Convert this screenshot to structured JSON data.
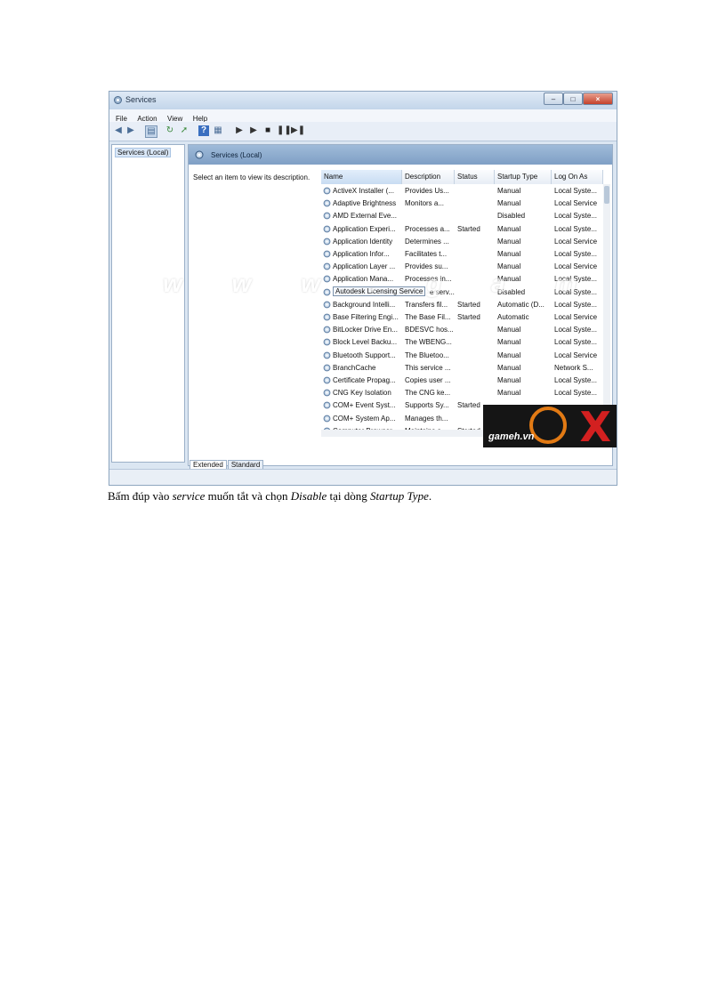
{
  "window": {
    "title": "Services",
    "min": "–",
    "max": "□",
    "close": "×"
  },
  "menu": [
    "File",
    "Action",
    "View",
    "Help"
  ],
  "tree": {
    "item": "Services (Local)"
  },
  "pane": {
    "header": "Services (Local)",
    "description": "Select an item to view its description."
  },
  "columns": [
    "Name",
    "Description",
    "Status",
    "Startup Type",
    "Log On As"
  ],
  "rows": [
    {
      "name": "ActiveX Installer (...",
      "desc": "Provides Us...",
      "status": "",
      "startup": "Manual",
      "logon": "Local Syste..."
    },
    {
      "name": "Adaptive Brightness",
      "desc": "Monitors a...",
      "status": "",
      "startup": "Manual",
      "logon": "Local Service"
    },
    {
      "name": "AMD External Eve...",
      "desc": "",
      "status": "",
      "startup": "Disabled",
      "logon": "Local Syste..."
    },
    {
      "name": "Application Experi...",
      "desc": "Processes a...",
      "status": "Started",
      "startup": "Manual",
      "logon": "Local Syste..."
    },
    {
      "name": "Application Identity",
      "desc": "Determines ...",
      "status": "",
      "startup": "Manual",
      "logon": "Local Service"
    },
    {
      "name": "Application Infor...",
      "desc": "Facilitates t...",
      "status": "",
      "startup": "Manual",
      "logon": "Local Syste..."
    },
    {
      "name": "Application Layer ...",
      "desc": "Provides su...",
      "status": "",
      "startup": "Manual",
      "logon": "Local Service"
    },
    {
      "name": "Application Mana...",
      "desc": "Processes in...",
      "status": "",
      "startup": "Manual",
      "logon": "Local Syste..."
    },
    {
      "name": "Autodesk Licensing Service",
      "desc": "e serv...",
      "status": "",
      "startup": "Disabled",
      "logon": "Local Syste..."
    },
    {
      "name": "Background Intelli...",
      "desc": "Transfers fil...",
      "status": "Started",
      "startup": "Automatic (D...",
      "logon": "Local Syste..."
    },
    {
      "name": "Base Filtering Engi...",
      "desc": "The Base Fil...",
      "status": "Started",
      "startup": "Automatic",
      "logon": "Local Service"
    },
    {
      "name": "BitLocker Drive En...",
      "desc": "BDESVC hos...",
      "status": "",
      "startup": "Manual",
      "logon": "Local Syste..."
    },
    {
      "name": "Block Level Backu...",
      "desc": "The WBENG...",
      "status": "",
      "startup": "Manual",
      "logon": "Local Syste..."
    },
    {
      "name": "Bluetooth Support...",
      "desc": "The Bluetoo...",
      "status": "",
      "startup": "Manual",
      "logon": "Local Service"
    },
    {
      "name": "BranchCache",
      "desc": "This service ...",
      "status": "",
      "startup": "Manual",
      "logon": "Network S..."
    },
    {
      "name": "Certificate Propag...",
      "desc": "Copies user ...",
      "status": "",
      "startup": "Manual",
      "logon": "Local Syste..."
    },
    {
      "name": "CNG Key Isolation",
      "desc": "The CNG ke...",
      "status": "",
      "startup": "Manual",
      "logon": "Local Syste..."
    },
    {
      "name": "COM+ Event Syst...",
      "desc": "Supports Sy...",
      "status": "Started",
      "startup": "",
      "logon": ""
    },
    {
      "name": "COM+ System Ap...",
      "desc": "Manages th...",
      "status": "",
      "startup": "",
      "logon": ""
    },
    {
      "name": "Computer Browser",
      "desc": "Maintains a...",
      "status": "Started",
      "startup": "",
      "logon": ""
    }
  ],
  "tabs": [
    "Extended",
    "Standard"
  ],
  "watermark": "w w w . g a m e h . v n",
  "logo": {
    "site": "gameh.vn",
    "letter": "X"
  },
  "caption": {
    "p1": "Bấm đúp vào ",
    "i1": "service",
    "p2": " muốn tắt và chọn ",
    "i2": "Disable",
    "p3": " tại dòng ",
    "i3": "Startup Type",
    "p4": "."
  }
}
